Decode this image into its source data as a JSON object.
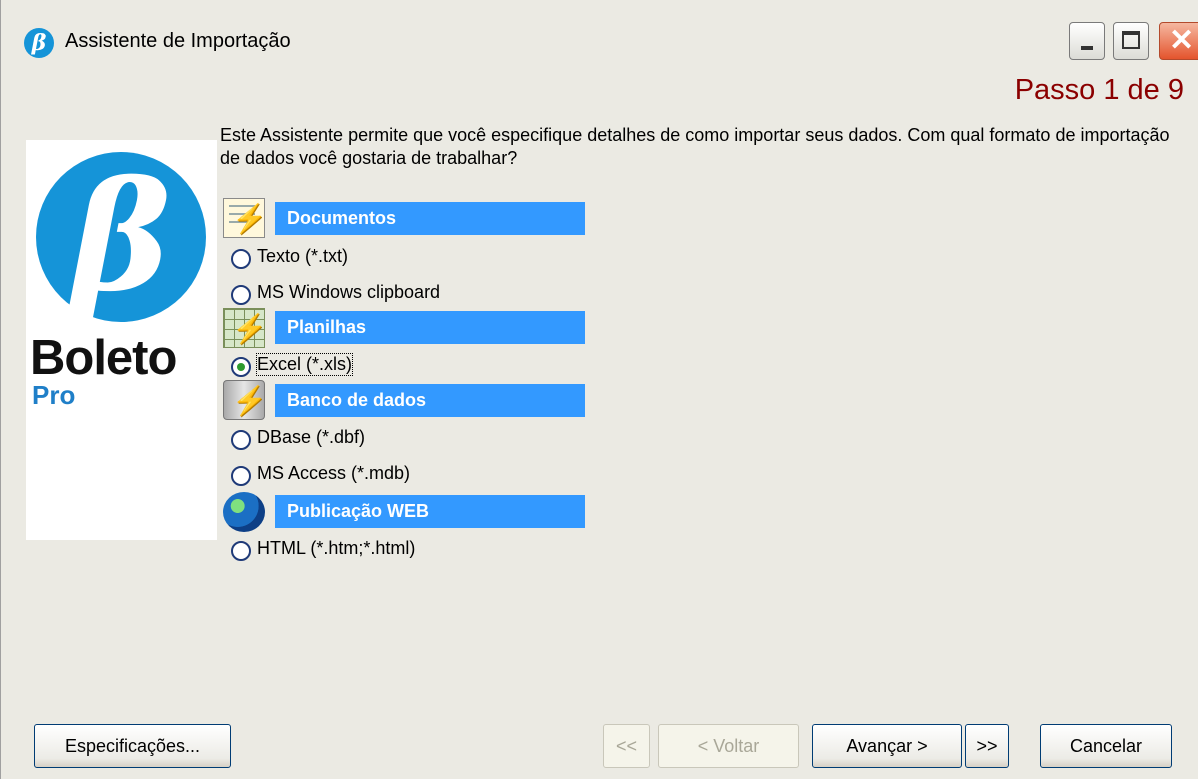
{
  "window": {
    "title": "Assistente de Importação",
    "app_icon": "beta-logo-icon"
  },
  "step": "Passo 1 de 9",
  "logo": {
    "word": "Boleto",
    "sub": "Pro",
    "brand_color": "#1594d8"
  },
  "intro": "Este Assistente permite que você especifique detalhes de como importar seus dados. Com qual formato de importação de dados você gostaria de trabalhar?",
  "categories": [
    {
      "label": "Documentos",
      "icon": "document-icon",
      "options": [
        {
          "label": "Texto (*.txt)",
          "checked": false
        },
        {
          "label": "MS Windows clipboard",
          "checked": false
        }
      ]
    },
    {
      "label": "Planilhas",
      "icon": "spreadsheet-icon",
      "options": [
        {
          "label": "Excel (*.xls)",
          "checked": true
        }
      ]
    },
    {
      "label": "Banco de dados",
      "icon": "database-icon",
      "options": [
        {
          "label": "DBase (*.dbf)",
          "checked": false
        },
        {
          "label": "MS Access (*.mdb)",
          "checked": false
        }
      ]
    },
    {
      "label": "Publicação WEB",
      "icon": "globe-icon",
      "options": [
        {
          "label": "HTML (*.htm;*.html)",
          "checked": false
        }
      ]
    }
  ],
  "buttons": {
    "specifications": "Especificações...",
    "first": "<<",
    "back": "< Voltar",
    "next": "Avançar >",
    "last": ">>",
    "cancel": "Cancelar"
  },
  "colors": {
    "category_bar": "#3399ff",
    "step_text": "#8b0000"
  }
}
